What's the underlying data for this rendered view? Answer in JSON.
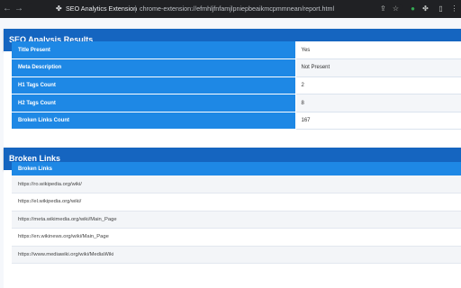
{
  "browser": {
    "extension_name": "SEO Analytics Extension",
    "url": "chrome-extension://efmhljfnfamjlpniepbeaikmcpmmnean/report.html"
  },
  "report": {
    "title": "SEO Analysis Results",
    "rows": [
      {
        "label": "Title Present",
        "value": "Yes"
      },
      {
        "label": "Meta Description",
        "value": "Not Present"
      },
      {
        "label": "H1 Tags Count",
        "value": "2"
      },
      {
        "label": "H2 Tags Count",
        "value": "8"
      },
      {
        "label": "Broken Links Count",
        "value": "167"
      }
    ]
  },
  "broken_links": {
    "title": "Broken Links",
    "column_header": "Broken Links",
    "items": [
      "https://ro.wikipedia.org/wiki/",
      "https://el.wikipedia.org/wiki/",
      "https://meta.wikimedia.org/wiki/Main_Page",
      "https://en.wikinews.org/wiki/Main_Page",
      "https://www.mediawiki.org/wiki/MediaWiki"
    ]
  },
  "colors": {
    "header_blue": "#1565c0",
    "cell_blue": "#1e88e5"
  }
}
